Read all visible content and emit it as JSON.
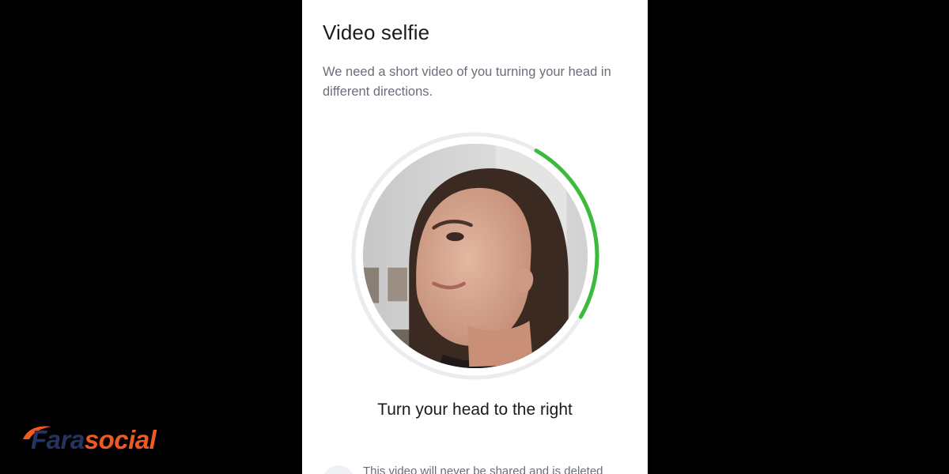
{
  "screen": {
    "title": "Video selfie",
    "subtitle": "We need a short video of you turning your head in different directions.",
    "instruction": "Turn your head to the right",
    "privacy_text": "This video will never be shared and is deleted"
  },
  "progress": {
    "fraction": 0.25,
    "color": "#3cba3c",
    "track_color": "#ececee"
  },
  "watermark": {
    "part_a": "Fara",
    "part_b": "social",
    "color_a": "#25335f",
    "color_b": "#ee5a1f"
  },
  "icons": {
    "privacy": "lock-icon"
  }
}
